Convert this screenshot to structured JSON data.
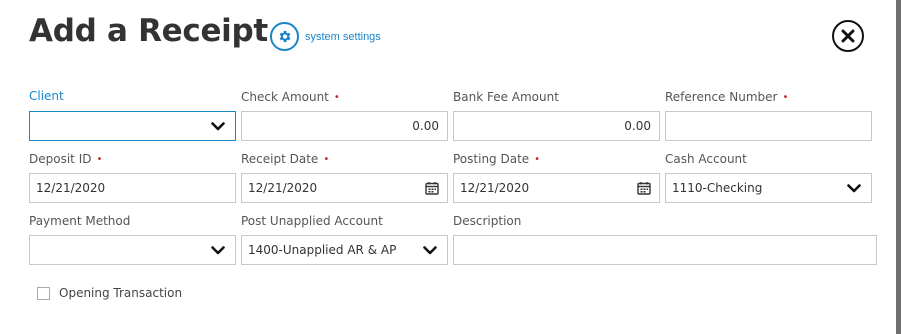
{
  "header": {
    "title": "Add a Receipt",
    "system_settings_label": "system settings",
    "gear_icon": "gear-icon",
    "close_icon": "close-icon"
  },
  "colors": {
    "accent": "#1a86c7",
    "required": "#c0282f",
    "border": "#c8c8c8"
  },
  "form": {
    "client": {
      "label": "Client",
      "value": "",
      "required": false
    },
    "check_amount": {
      "label": "Check Amount",
      "value": "0.00",
      "required": true
    },
    "bank_fee_amount": {
      "label": "Bank Fee Amount",
      "value": "0.00",
      "required": false
    },
    "reference_number": {
      "label": "Reference Number",
      "value": "",
      "required": true
    },
    "deposit_id": {
      "label": "Deposit ID",
      "value": "12/21/2020",
      "required": true
    },
    "receipt_date": {
      "label": "Receipt Date",
      "value": "12/21/2020",
      "required": true
    },
    "posting_date": {
      "label": "Posting Date",
      "value": "12/21/2020",
      "required": true
    },
    "cash_account": {
      "label": "Cash Account",
      "value": "1110-Checking",
      "required": false
    },
    "payment_method": {
      "label": "Payment Method",
      "value": "",
      "required": false
    },
    "post_unapplied_account": {
      "label": "Post Unapplied Account",
      "value": "1400-Unapplied AR & AP",
      "required": false
    },
    "description": {
      "label": "Description",
      "value": "",
      "required": false
    },
    "opening_transaction": {
      "label": "Opening Transaction",
      "checked": false
    }
  },
  "required_marker": "•"
}
